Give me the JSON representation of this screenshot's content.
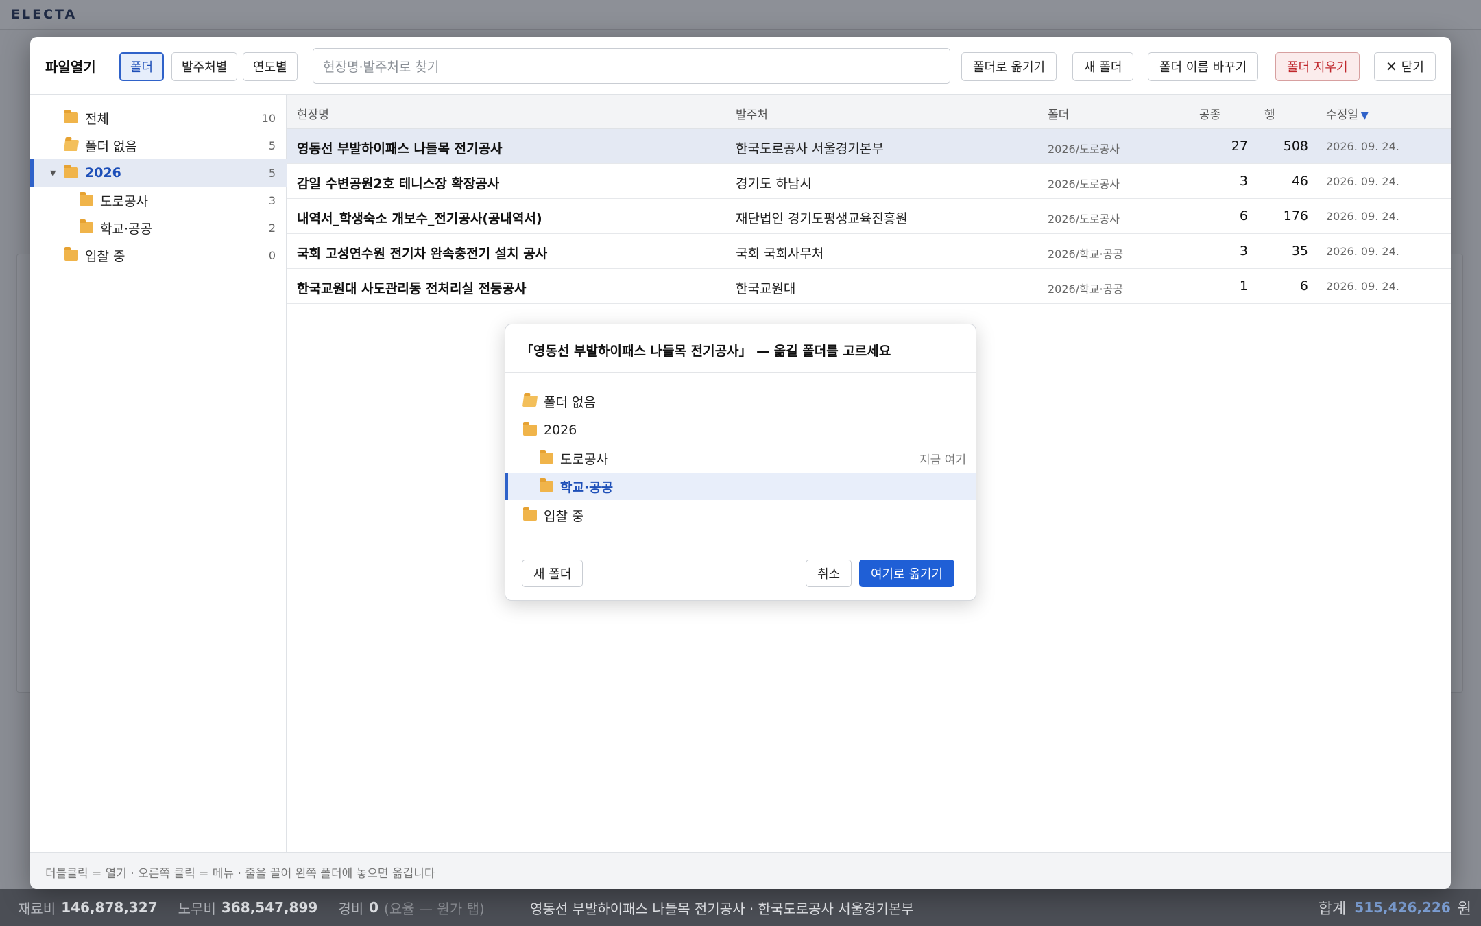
{
  "app": {
    "logo": "ELECTA"
  },
  "dialog": {
    "title": "파일열기",
    "view_tabs": [
      "폴더",
      "발주처별",
      "연도별"
    ],
    "search_placeholder": "현장명·발주처로 찾기",
    "actions": {
      "move_to_folder": "폴더로 옮기기",
      "new_folder": "새 폴더",
      "rename_folder": "폴더 이름 바꾸기",
      "delete_folder": "폴더 지우기",
      "close": "닫기"
    },
    "tree": [
      {
        "label": "전체",
        "count": "10"
      },
      {
        "label": "폴더 없음",
        "count": "5"
      },
      {
        "label": "2026",
        "count": "5"
      },
      {
        "label": "도로공사",
        "count": "3"
      },
      {
        "label": "학교·공공",
        "count": "2"
      },
      {
        "label": "입찰 중",
        "count": "0"
      }
    ],
    "columns": {
      "name": "현장명",
      "client": "발주처",
      "folder": "폴더",
      "trades": "공종",
      "rows": "행",
      "modified": "수정일"
    },
    "rows": [
      {
        "name": "영동선 부발하이패스 나들목 전기공사",
        "client": "한국도로공사 서울경기본부",
        "folder": "2026/도로공사",
        "trades": "27",
        "rows": "508",
        "modified": "2026. 09. 24."
      },
      {
        "name": "감일 수변공원2호 테니스장 확장공사",
        "client": "경기도 하남시",
        "folder": "2026/도로공사",
        "trades": "3",
        "rows": "46",
        "modified": "2026. 09. 24."
      },
      {
        "name": "내역서_학생숙소 개보수_전기공사(공내역서)",
        "client": "재단법인 경기도평생교육진흥원",
        "folder": "2026/도로공사",
        "trades": "6",
        "rows": "176",
        "modified": "2026. 09. 24."
      },
      {
        "name": "국회 고성연수원 전기차 완속충전기 설치 공사",
        "client": "국회 국회사무처",
        "folder": "2026/학교·공공",
        "trades": "3",
        "rows": "35",
        "modified": "2026. 09. 24."
      },
      {
        "name": "한국교원대 사도관리동 전처리실 전등공사",
        "client": "한국교원대",
        "folder": "2026/학교·공공",
        "trades": "1",
        "rows": "6",
        "modified": "2026. 09. 24."
      }
    ],
    "footer_hint": "더블클릭 = 열기 · 오른쪽 클릭 = 메뉴 · 줄을 끌어 왼쪽 폴더에 놓으면 옮깁니다"
  },
  "move_modal": {
    "title": "「영동선 부발하이패스 나들목 전기공사」 — 옮길 폴더를 고르세요",
    "folders": [
      "폴더 없음",
      "2026",
      "도로공사",
      "학교·공공",
      "입찰 중"
    ],
    "current_note": "지금 여기",
    "new_folder": "새 폴더",
    "cancel": "취소",
    "confirm": "여기로 옮기기"
  },
  "status_bar": {
    "material_label": "재료비",
    "material_value": "146,878,327",
    "labor_label": "노무비",
    "labor_value": "368,547,899",
    "expense_label": "경비",
    "expense_value": "0",
    "expense_note": "(요율 — 원가 탭)",
    "current_project": "영동선 부발하이패스 나들목 전기공사 · 한국도로공사 서울경기본부",
    "total_label": "합계",
    "total_value": "515,426,226",
    "total_unit": "원"
  },
  "colors": {
    "accent": "#2f62c9",
    "primary_button": "#1f5fd6",
    "danger": "#c0282d",
    "folder": "#f0b44a"
  }
}
